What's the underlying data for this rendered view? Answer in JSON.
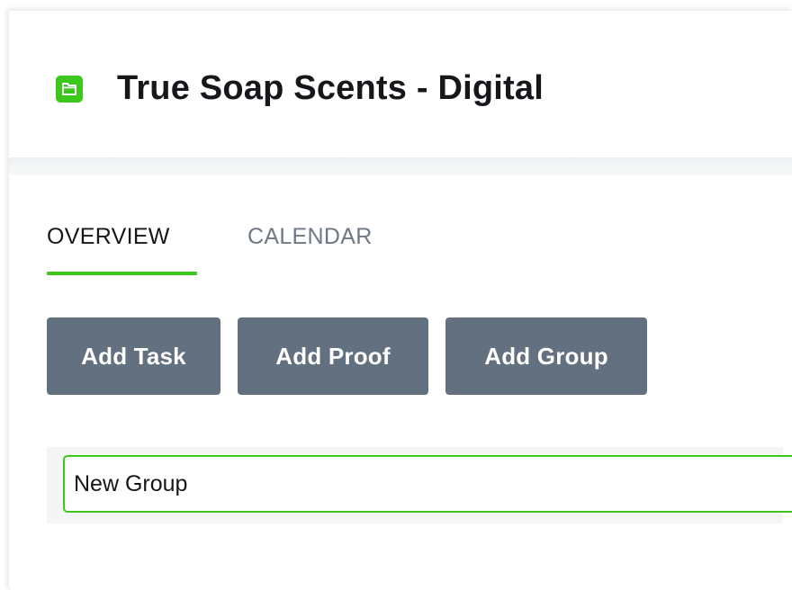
{
  "project": {
    "title": "True Soap Scents - Digital",
    "icon": "folder-icon",
    "icon_color": "#3cc71d"
  },
  "tabs": [
    {
      "label": "OVERVIEW",
      "active": true
    },
    {
      "label": "CALENDAR",
      "active": false
    }
  ],
  "toolbar": {
    "add_task_label": "Add Task",
    "add_proof_label": "Add Proof",
    "add_group_label": "Add Group",
    "button_color": "#627080"
  },
  "new_group": {
    "value": "New Group",
    "focus_color": "#3cc71d"
  },
  "colors": {
    "accent": "#3cc71d",
    "text": "#15171a",
    "muted_tab": "#6d7884"
  }
}
